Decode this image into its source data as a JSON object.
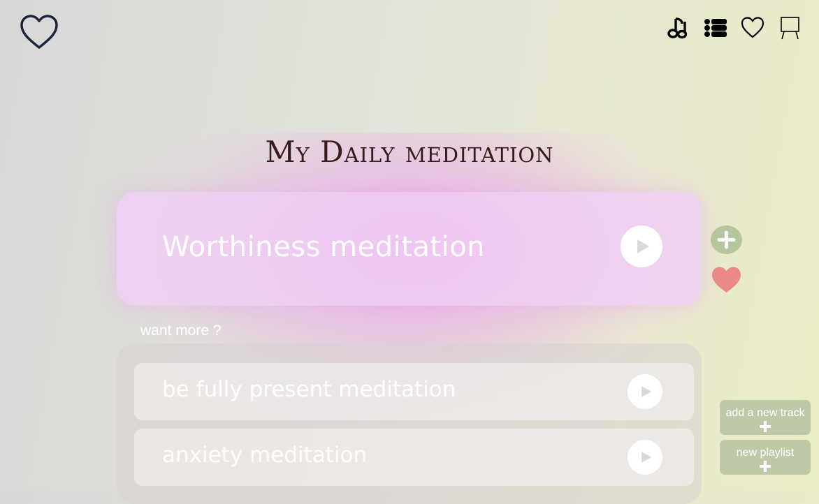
{
  "header": {
    "title": "My Daily meditation",
    "nav_icons": [
      "music-note-icon",
      "list-icon",
      "heart-icon",
      "easel-icon"
    ]
  },
  "current_track": {
    "title": "Worthiness meditation"
  },
  "more": {
    "label": "want more ?",
    "items": [
      {
        "title": "be fully present  meditation"
      },
      {
        "title": "anxiety meditation"
      }
    ]
  },
  "actions": {
    "add_track": "add a new track",
    "new_playlist": "new playlist"
  },
  "colors": {
    "accent_green": "#b5c59c",
    "heart_red": "#e98989",
    "title": "#3a1a1a",
    "glow": "#e896eb"
  }
}
